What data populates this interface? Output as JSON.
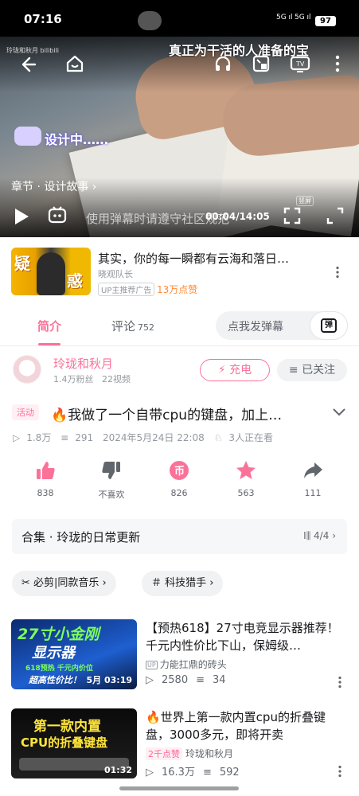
{
  "status_bar": {
    "time": "07:16",
    "signal1": "5G ıl",
    "signal2": "5G ıl",
    "battery": "97"
  },
  "player": {
    "watermark": "玲珑和秋月 bilibili",
    "danmaku_top": "真正为干活的人准备的宝",
    "caption": "设计中……",
    "chapter": "章节 · 设计故事 ›",
    "danmaku_input_hint": "使用弹幕时请遵守社区规范",
    "time": "00:04/14:05",
    "fullscreen_label": "竖屏"
  },
  "ad": {
    "thumb_char1": "疑",
    "thumb_char2": "惑",
    "title": "其实，你的每一瞬都有云海和落日…",
    "author": "晓观队长",
    "tag": "UP主推荐广告",
    "likes": "13万点赞"
  },
  "tabs": {
    "intro": "简介",
    "comments": "评论",
    "comments_count": "752",
    "danmaku_placeholder": "点我发弹幕",
    "danmaku_btn": "弹"
  },
  "author": {
    "name": "玲珑和秋月",
    "fans": "1.4万粉丝",
    "videos": "22视频",
    "charge": "⚡ 充电",
    "follow": "≡ 已关注"
  },
  "video": {
    "tag": "活动",
    "title": "🔥我做了一个自带cpu的键盘，加上…",
    "views": "1.8万",
    "danmaku_count": "291",
    "date": "2024年5月24日 22:08",
    "watching": "3人正在看"
  },
  "actions": [
    {
      "name": "like",
      "label": "838"
    },
    {
      "name": "dislike",
      "label": "不喜欢"
    },
    {
      "name": "coin",
      "label": "826"
    },
    {
      "name": "favorite",
      "label": "563"
    },
    {
      "name": "share",
      "label": "111"
    }
  ],
  "collection": {
    "title": "合集 · 玲珑的日常更新",
    "progress": "4/4"
  },
  "chips": [
    {
      "label": "必剪|同款音乐 ›"
    },
    {
      "label": "科技猎手 ›"
    }
  ],
  "recommendations": [
    {
      "thumb_line1": "27寸小金刚",
      "thumb_line2": "显示器",
      "thumb_line3": "618预热 千元内价位",
      "thumb_line4": "超高性价比！",
      "duration": "5月 03:19",
      "title": "【预热618】27寸电竞显示器推荐！千元内性价比下山，保姆级…",
      "up": "力能扛鼎的砖头",
      "views": "2580",
      "danmaku": "34"
    },
    {
      "thumb_line1": "第一款内置",
      "thumb_line2": "CPU的折叠键盘",
      "duration": "01:32",
      "title": "🔥世界上第一款内置cpu的折叠键盘，3000多元，即将开卖",
      "hot": "2千点赞",
      "up": "玲珑和秋月",
      "views": "16.3万",
      "danmaku": "592"
    }
  ],
  "colors": {
    "accent": "#fb7299",
    "text": "#18191c",
    "muted": "#9499a0"
  }
}
